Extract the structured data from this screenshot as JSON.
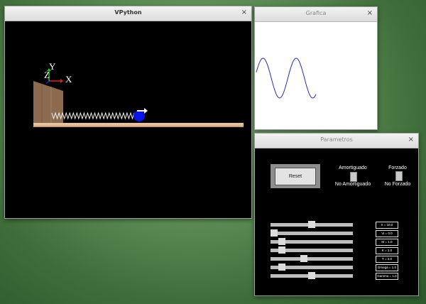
{
  "vpython_window": {
    "title": "VPython",
    "axis_x": "X",
    "axis_y": "Y",
    "axis_z": "Z"
  },
  "grafica_window": {
    "title": "Grafica"
  },
  "parametros_window": {
    "title": "Parametros",
    "reset_label": "Reset",
    "amortiguado": {
      "on_label": "Amortiguado",
      "off_label": "No Amortiguado"
    },
    "forzado": {
      "on_label": "Forzado",
      "off_label": "No Forzado"
    },
    "values": [
      "X = 10.0",
      "Vi = 0.0",
      "M = 1.0",
      "K = 1.0",
      "T = 4.0",
      "Omega = 1.0",
      "Gamma = 1.0"
    ],
    "sliders": [
      0.5,
      0.0,
      0.1,
      0.1,
      0.4,
      0.1,
      0.5
    ]
  },
  "close_glyph": "×",
  "colors": {
    "desktop": "#5f8f57",
    "scene_bg": "#000000",
    "ball": "#0a16e6",
    "floor": "#e6c39e",
    "wall": "#8b6a50",
    "graph_line": "#2b2bb5"
  }
}
